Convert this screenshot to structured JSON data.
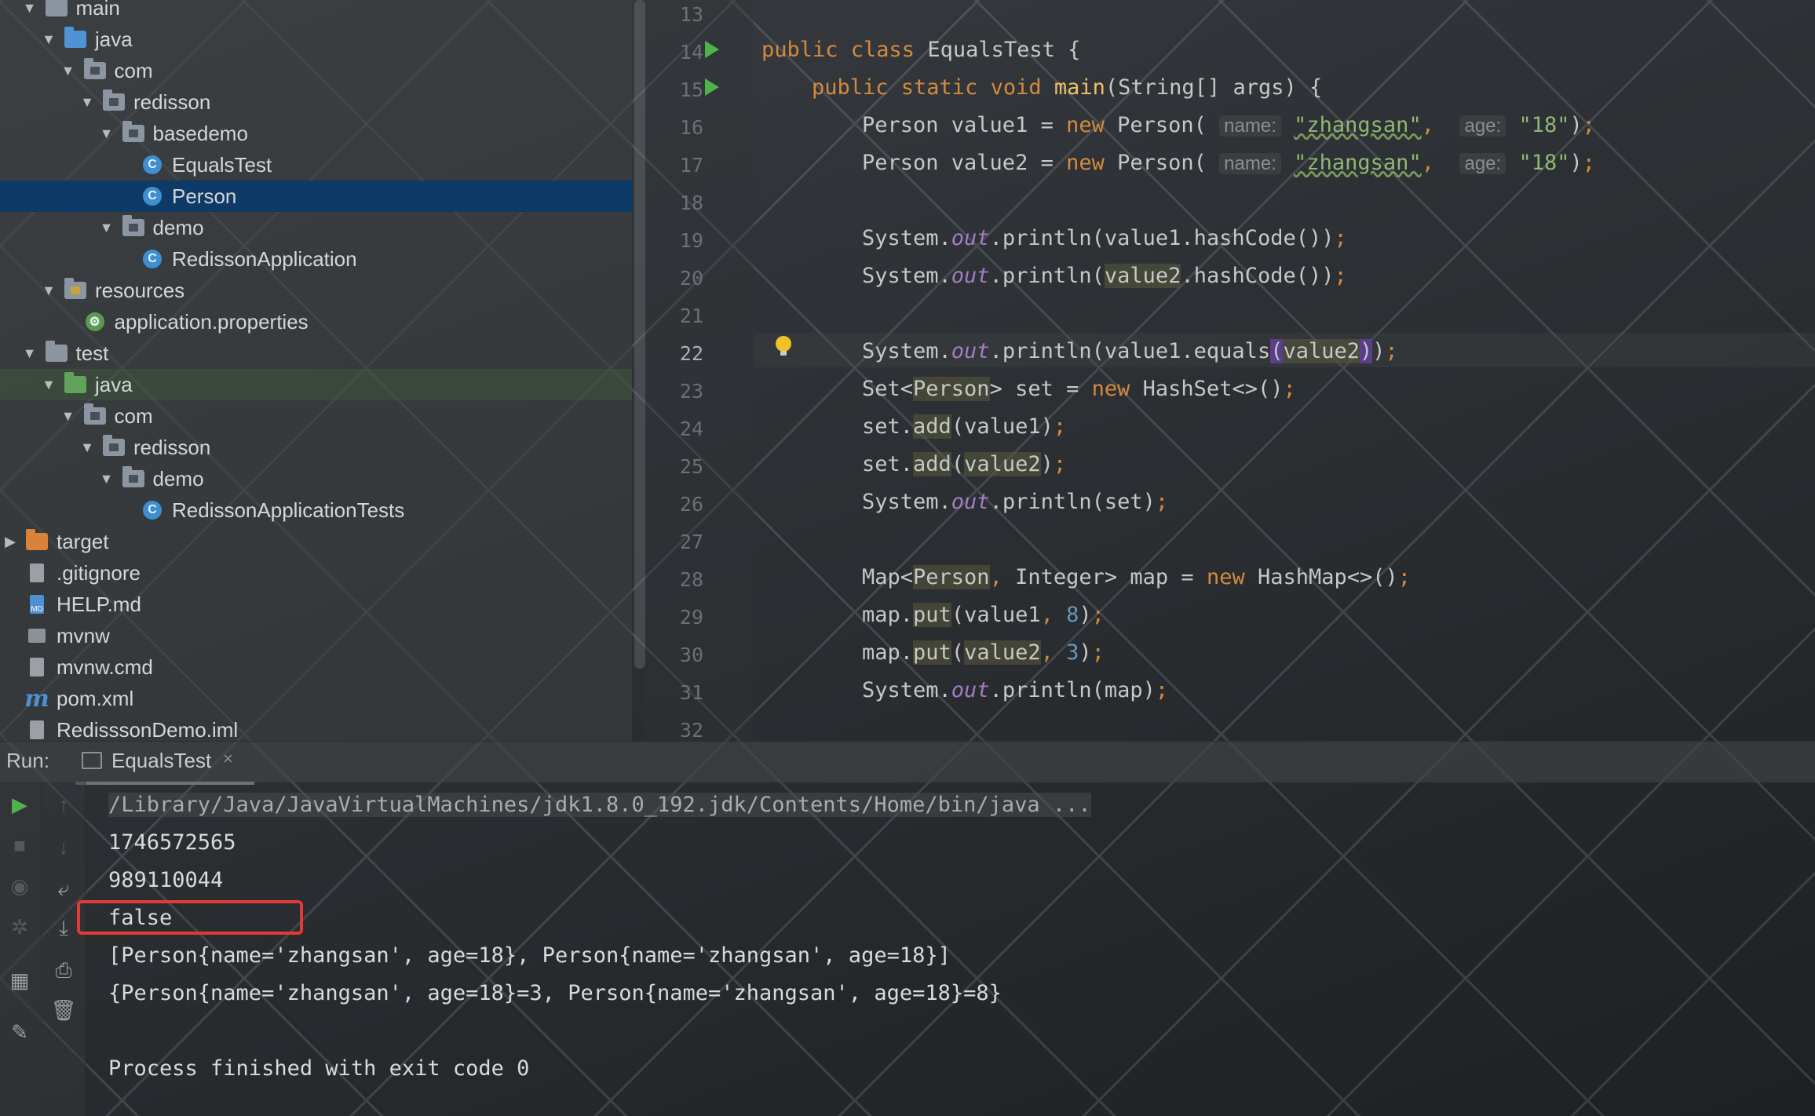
{
  "tree": {
    "rows": [
      {
        "label": "main",
        "icon": "folder",
        "depth": 2,
        "arrow": "down"
      },
      {
        "label": "java",
        "icon": "folder-blue",
        "depth": 3,
        "arrow": "down"
      },
      {
        "label": "com",
        "icon": "package",
        "depth": 4,
        "arrow": "down"
      },
      {
        "label": "redisson",
        "icon": "package",
        "depth": 5,
        "arrow": "down"
      },
      {
        "label": "basedemo",
        "icon": "package",
        "depth": 6,
        "arrow": "down"
      },
      {
        "label": "EqualsTest",
        "icon": "class",
        "depth": 7,
        "arrow": ""
      },
      {
        "label": "Person",
        "icon": "class",
        "depth": 7,
        "arrow": "",
        "selected": true
      },
      {
        "label": "demo",
        "icon": "package",
        "depth": 6,
        "arrow": "down"
      },
      {
        "label": "RedissonApplication",
        "icon": "class",
        "depth": 7,
        "arrow": ""
      },
      {
        "label": "resources",
        "icon": "folder-resources",
        "depth": 3,
        "arrow": "down"
      },
      {
        "label": "application.properties",
        "icon": "properties",
        "depth": 4,
        "arrow": ""
      },
      {
        "label": "test",
        "icon": "folder",
        "depth": 2,
        "arrow": "down"
      },
      {
        "label": "java",
        "icon": "folder-green",
        "depth": 3,
        "arrow": "down"
      },
      {
        "label": "com",
        "icon": "package",
        "depth": 4,
        "arrow": "down"
      },
      {
        "label": "redisson",
        "icon": "package",
        "depth": 5,
        "arrow": "down"
      },
      {
        "label": "demo",
        "icon": "package",
        "depth": 6,
        "arrow": "down"
      },
      {
        "label": "RedissonApplicationTests",
        "icon": "class",
        "depth": 7,
        "arrow": ""
      },
      {
        "label": "target",
        "icon": "folder-orange",
        "depth": 1,
        "arrow": "right"
      },
      {
        "label": ".gitignore",
        "icon": "file",
        "depth": 1,
        "arrow": ""
      },
      {
        "label": "HELP.md",
        "icon": "file-md",
        "depth": 1,
        "arrow": ""
      },
      {
        "label": "mvnw",
        "icon": "file-exec",
        "depth": 1,
        "arrow": ""
      },
      {
        "label": "mvnw.cmd",
        "icon": "file",
        "depth": 1,
        "arrow": ""
      },
      {
        "label": "pom.xml",
        "icon": "maven",
        "depth": 1,
        "arrow": ""
      },
      {
        "label": "RedisssonDemo.iml",
        "icon": "file",
        "depth": 1,
        "arrow": ""
      }
    ]
  },
  "editor": {
    "line_numbers": [
      "13",
      "14",
      "15",
      "16",
      "17",
      "18",
      "19",
      "20",
      "21",
      "22",
      "23",
      "24",
      "25",
      "26",
      "27",
      "28",
      "29",
      "30",
      "31",
      "32"
    ],
    "current_line": "22",
    "hints": {
      "name": "name:",
      "age": "age:"
    },
    "strings": {
      "zhangsan": "\"zhangsan\"",
      "age18": "\"18\""
    },
    "numbers": {
      "eight": "8",
      "three": "3"
    }
  },
  "run": {
    "label": "Run:",
    "tab": "EqualsTest",
    "close": "×",
    "output": [
      "/Library/Java/JavaVirtualMachines/jdk1.8.0_192.jdk/Contents/Home/bin/java ...",
      "1746572565",
      "989110044",
      "false",
      "[Person{name='zhangsan', age=18}, Person{name='zhangsan', age=18}]",
      "{Person{name='zhangsan', age=18}=3, Person{name='zhangsan', age=18}=8}",
      "",
      "Process finished with exit code 0"
    ]
  },
  "colors": {
    "accent_red": "#e23b33",
    "keyword": "#d4893f",
    "string": "#8fb870",
    "selection": "#0d3a66"
  }
}
